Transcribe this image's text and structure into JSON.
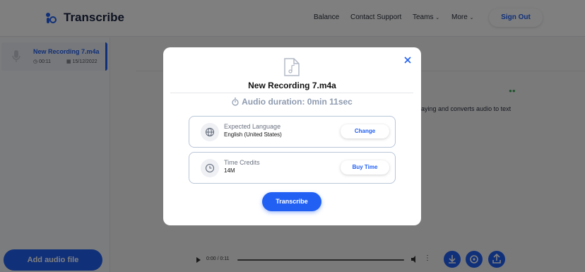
{
  "header": {
    "brand": "Transcribe",
    "nav": {
      "balance": "Balance",
      "support": "Contact Support",
      "teams": "Teams",
      "more": "More"
    },
    "signout": "Sign Out"
  },
  "sidebar": {
    "recording": {
      "name": "New Recording 7.m4a",
      "duration": "00:11",
      "date": "15/12/2022"
    },
    "add_button": "Add audio file"
  },
  "main": {
    "description_fragment": "aying and converts audio to text"
  },
  "player": {
    "time": "0:00 / 0:11"
  },
  "modal": {
    "title": "New Recording 7.m4a",
    "duration": "Audio duration: 0min 11sec",
    "language": {
      "label": "Expected Language",
      "value": "English (United States)",
      "button": "Change"
    },
    "credits": {
      "label": "Time Credits",
      "value": "14M",
      "button": "Buy Time"
    },
    "transcribe_button": "Transcribe"
  },
  "colors": {
    "accent": "#2160f3",
    "overlay": "rgba(0,0,0,0.5)",
    "card_border": "#b9c6d8",
    "muted": "#8e9bb0"
  }
}
